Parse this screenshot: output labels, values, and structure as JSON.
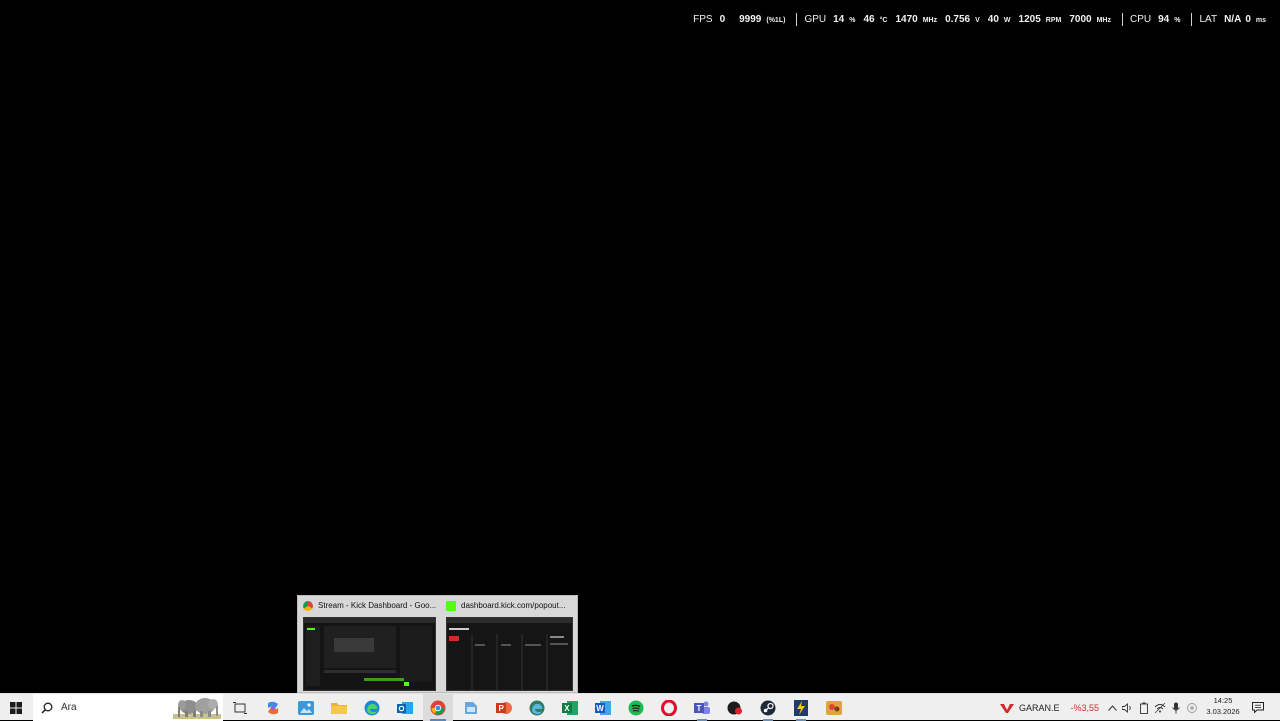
{
  "overlay": {
    "fps": {
      "label": "FPS",
      "value": "0",
      "max": "9999",
      "extra": "(%1L)"
    },
    "gpu": {
      "label": "GPU",
      "load": "14",
      "load_unit": "%",
      "temp": "46",
      "temp_unit": "°C",
      "clock": "1470",
      "clock_unit": "MHz",
      "voltage": "0.756",
      "voltage_unit": "V",
      "power": "40",
      "power_unit": "W",
      "fan": "1205",
      "fan_unit": "RPM",
      "mem_clock": "7000",
      "mem_clock_unit": "MHz"
    },
    "cpu": {
      "label": "CPU",
      "load": "94",
      "load_unit": "%"
    },
    "lat": {
      "label": "LAT",
      "value": "N/A",
      "value2": "0",
      "unit": "ms"
    }
  },
  "thumbnails": [
    {
      "title": "Stream - Kick Dashboard - Goo...",
      "icon": "chrome-icon"
    },
    {
      "title": "dashboard.kick.com/popout...",
      "icon": "kick-icon"
    }
  ],
  "taskbar": {
    "search_placeholder": "Ara",
    "apps": [
      "task-view",
      "copilot",
      "photos",
      "file-explorer",
      "edge",
      "outlook",
      "chrome",
      "app-window",
      "powerpoint",
      "edge-dev",
      "excel",
      "word",
      "spotify",
      "opera",
      "teams",
      "red-app",
      "steam",
      "vpn-app",
      "game-app"
    ],
    "stock": {
      "name": "GARAN.E",
      "change": "-%3,55"
    },
    "clock": {
      "time": "14:25",
      "date": "3.03.2026"
    }
  },
  "colors": {
    "accent": "#5a87b8",
    "stock_down": "#d02a2a",
    "overlay_text": "#f2f2f2"
  }
}
